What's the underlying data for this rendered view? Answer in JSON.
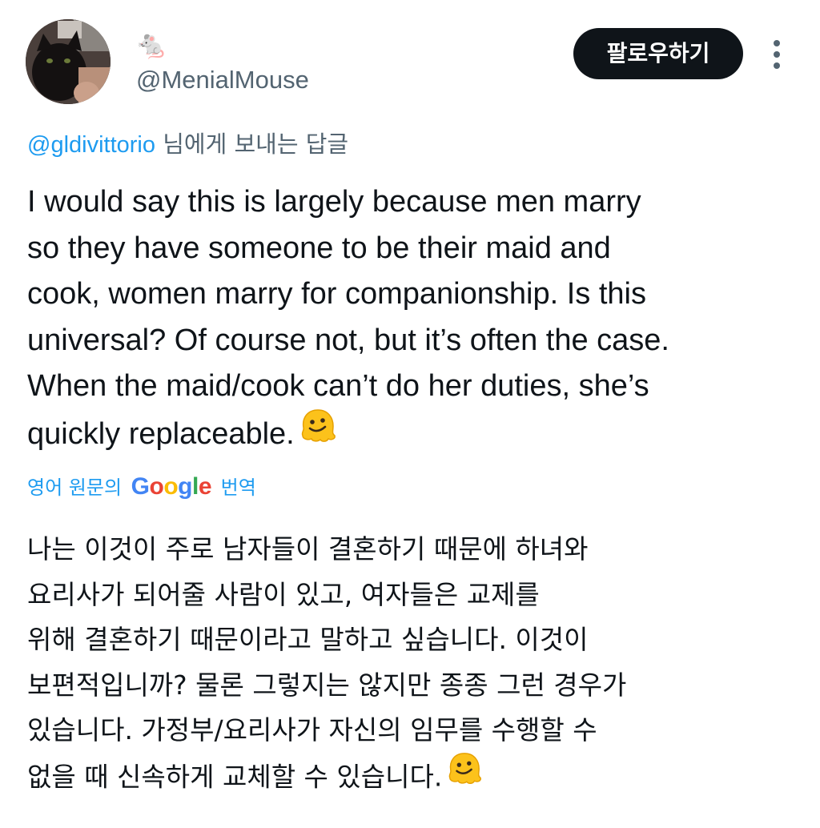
{
  "author": {
    "display_name": "🐁",
    "handle": "@MenialMouse",
    "avatar_icon": "cat-photo-avatar"
  },
  "actions": {
    "follow_label": "팔로우하기",
    "more_icon": "vertical-ellipsis-icon"
  },
  "reply_context": {
    "mention": "@gldivittorio",
    "suffix": " 님에게 보내는 답글"
  },
  "tweet": {
    "text_lines": [
      "I would say this is largely because men marry",
      "so they have someone to be their maid and",
      "cook, women marry for companionship. Is this",
      "universal? Of course not, but it’s often the case.",
      "When the maid/cook can’t do her duties, she’s",
      "quickly replaceable."
    ],
    "emoji_icon": "melting-face-emoji-icon"
  },
  "translation": {
    "prefix": "영어 원문의",
    "brand": "Google",
    "suffix": "번역",
    "lines": [
      "나는 이것이 주로 남자들이 결혼하기 때문에 하녀와",
      "요리사가 되어줄 사람이 있고, 여자들은 교제를",
      "위해 결혼하기 때문이라고 말하고 싶습니다. 이것이",
      "보편적입니까?  물론 그렇지는 않지만 종종 그런 경우가",
      "있습니다. 가정부/요리사가 자신의 임무를 수행할 수",
      "없을 때 신속하게 교체할 수 있습니다."
    ]
  },
  "colors": {
    "text": "#0f1419",
    "secondary": "#536471",
    "accent": "#1d9bf0",
    "button_bg": "#0f1419"
  }
}
